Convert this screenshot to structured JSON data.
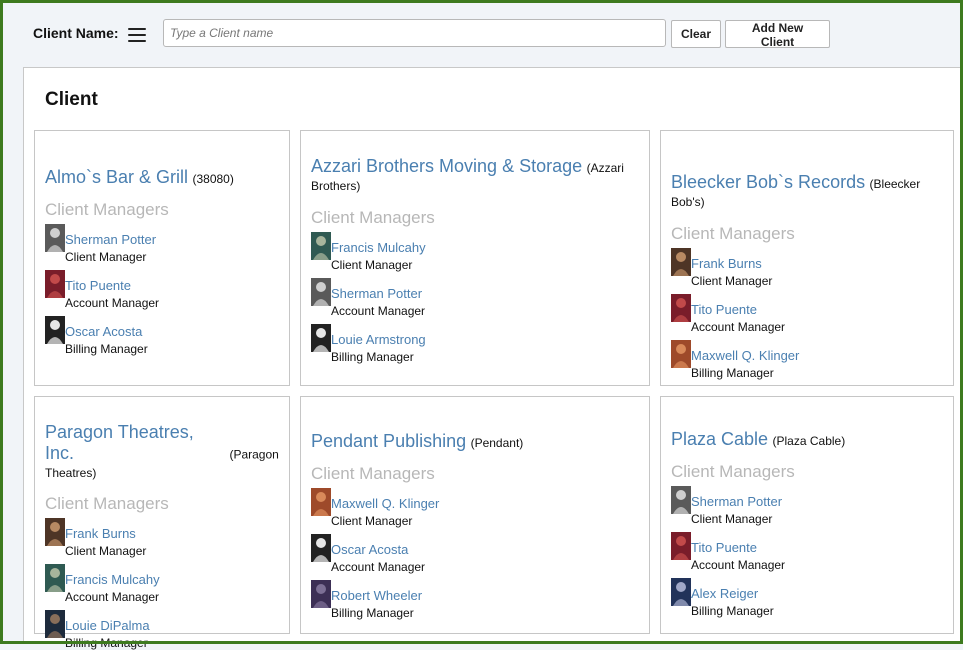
{
  "header": {
    "client_name_label": "Client Name:",
    "search_placeholder": "Type a Client name",
    "clear_label": "Clear",
    "add_label": "Add New Client"
  },
  "panel": {
    "title": "Client"
  },
  "managers_heading": "Client Managers",
  "clients": [
    {
      "name": "Almo`s Bar & Grill",
      "alias": "(38080)",
      "managers": [
        {
          "name": "Sherman Potter",
          "role": "Client Manager",
          "avatar": "bw-uniform"
        },
        {
          "name": "Tito Puente",
          "role": "Account Manager",
          "avatar": "red-stage"
        },
        {
          "name": "Oscar Acosta",
          "role": "Billing Manager",
          "avatar": "bw-portrait"
        }
      ]
    },
    {
      "name": "Azzari Brothers Moving & Storage",
      "alias": "(Azzari Brothers)",
      "managers": [
        {
          "name": "Francis Mulcahy",
          "role": "Client Manager",
          "avatar": "teal-photo"
        },
        {
          "name": "Sherman Potter",
          "role": "Account Manager",
          "avatar": "bw-uniform"
        },
        {
          "name": "Louie Armstrong",
          "role": "Billing Manager",
          "avatar": "bw-portrait"
        }
      ]
    },
    {
      "name": "Bleecker Bob`s Records",
      "alias": "(Bleecker Bob's)",
      "managers": [
        {
          "name": "Frank Burns",
          "role": "Client Manager",
          "avatar": "brown-photo"
        },
        {
          "name": "Tito Puente",
          "role": "Account Manager",
          "avatar": "red-stage"
        },
        {
          "name": "Maxwell Q. Klinger",
          "role": "Billing Manager",
          "avatar": "orange-photo"
        }
      ]
    },
    {
      "name": "Paragon Theatres, Inc.",
      "alias": "(Paragon Theatres)",
      "managers": [
        {
          "name": "Frank Burns",
          "role": "Client Manager",
          "avatar": "brown-photo"
        },
        {
          "name": "Francis Mulcahy",
          "role": "Account Manager",
          "avatar": "teal-photo"
        },
        {
          "name": "Louie DiPalma",
          "role": "Billing Manager",
          "avatar": "dark-photo"
        }
      ]
    },
    {
      "name": "Pendant Publishing",
      "alias": "(Pendant)",
      "managers": [
        {
          "name": "Maxwell Q. Klinger",
          "role": "Client Manager",
          "avatar": "orange-photo"
        },
        {
          "name": "Oscar Acosta",
          "role": "Account Manager",
          "avatar": "bw-portrait"
        },
        {
          "name": "Robert Wheeler",
          "role": "Billing Manager",
          "avatar": "purple-photo"
        }
      ]
    },
    {
      "name": "Plaza Cable",
      "alias": "(Plaza Cable)",
      "managers": [
        {
          "name": "Sherman Potter",
          "role": "Client Manager",
          "avatar": "bw-uniform"
        },
        {
          "name": "Tito Puente",
          "role": "Account Manager",
          "avatar": "red-stage"
        },
        {
          "name": "Alex Reiger",
          "role": "Billing Manager",
          "avatar": "blue-photo"
        }
      ]
    }
  ],
  "avatar_colors": {
    "bw-uniform": [
      "#5a5a5a",
      "#cfcfcf"
    ],
    "bw-portrait": [
      "#222222",
      "#e6e6e6"
    ],
    "red-stage": [
      "#7a1d2a",
      "#c24a4a"
    ],
    "teal-photo": [
      "#2f5a52",
      "#a7b59c"
    ],
    "brown-photo": [
      "#4e3526",
      "#b88a63"
    ],
    "orange-photo": [
      "#9e4a2a",
      "#d98a5a"
    ],
    "dark-photo": [
      "#1e2b3c",
      "#8a6f5a"
    ],
    "purple-photo": [
      "#3c2f55",
      "#7c6f95"
    ],
    "blue-photo": [
      "#22335a",
      "#a0a8c8"
    ]
  }
}
